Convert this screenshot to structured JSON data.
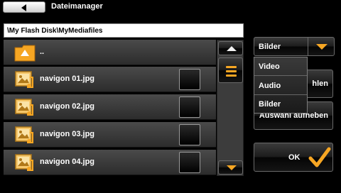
{
  "header": {
    "back_icon": "arrow-left-icon",
    "title": "Dateimanager"
  },
  "path": "\\My Flash Disk\\MyMediafiles",
  "files": [
    {
      "name": "..",
      "icon": "folder-up-icon",
      "has_checkbox": false
    },
    {
      "name": "navigon 01.jpg",
      "icon": "image-file-icon",
      "has_checkbox": true
    },
    {
      "name": "navigon 02.jpg",
      "icon": "image-file-icon",
      "has_checkbox": true
    },
    {
      "name": "navigon 03.jpg",
      "icon": "image-file-icon",
      "has_checkbox": true
    },
    {
      "name": "navigon 04.jpg",
      "icon": "image-file-icon",
      "has_checkbox": true
    }
  ],
  "filter": {
    "selected": "Bilder",
    "options": [
      "Video",
      "Audio",
      "Bilder"
    ]
  },
  "buttons": {
    "select_all_partial": "hlen",
    "deselect_partial": "Auswahl aufheben",
    "ok": "OK"
  },
  "colors": {
    "accent": "#f6a623",
    "background": "#000000"
  }
}
